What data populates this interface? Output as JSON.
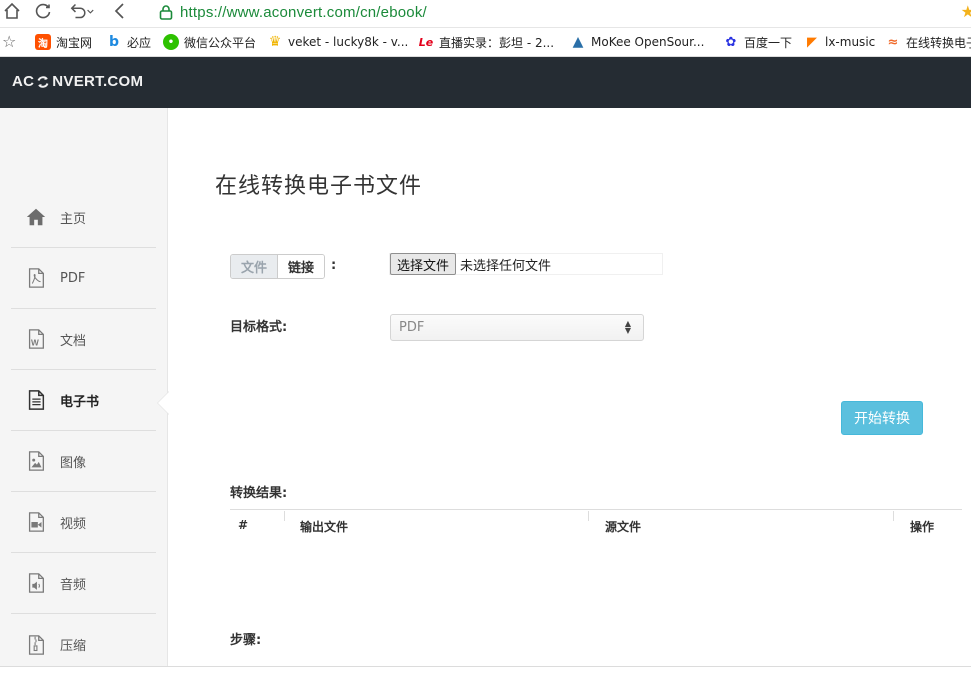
{
  "browser": {
    "url": "https://www.aconvert.com/cn/ebook/",
    "bookmarks": [
      {
        "label": "淘宝网",
        "icon": "taobao-icon",
        "color": "#ff5000",
        "glyph": "淘"
      },
      {
        "label": "必应",
        "icon": "bing-icon",
        "color": "#1e8ae0",
        "glyph": "b"
      },
      {
        "label": "微信公众平台",
        "icon": "wechat-icon",
        "color": "#2dc100",
        "glyph": "●"
      },
      {
        "label": "veket - lucky8k - v...",
        "icon": "trophy-icon",
        "color": "#f0b400",
        "glyph": "♛"
      },
      {
        "label": "直播实录：彭坦 - 2...",
        "icon": "letv-icon",
        "color": "#e3001b",
        "glyph": "Le"
      },
      {
        "label": "MoKee OpenSour...",
        "icon": "mokee-icon",
        "color": "#2a6fa8",
        "glyph": "M"
      },
      {
        "label": "百度一下",
        "icon": "baidu-icon",
        "color": "#2932e1",
        "glyph": "百"
      },
      {
        "label": "lx-music",
        "icon": "lx-music-icon",
        "color": "#ff7a00",
        "glyph": "▶"
      },
      {
        "label": "在线转换电子",
        "icon": "aconvert-icon",
        "color": "#f06a2a",
        "glyph": "≈"
      }
    ]
  },
  "site": {
    "logo_left": "AC",
    "logo_right": "NVERT.COM"
  },
  "sidebar": {
    "items": [
      {
        "label": "主页",
        "icon": "home-icon",
        "active": false
      },
      {
        "label": "PDF",
        "icon": "pdf-file-icon",
        "active": false
      },
      {
        "label": "文档",
        "icon": "word-document-icon",
        "active": false
      },
      {
        "label": "电子书",
        "icon": "ebook-icon",
        "active": true
      },
      {
        "label": "图像",
        "icon": "image-icon",
        "active": false
      },
      {
        "label": "视频",
        "icon": "video-icon",
        "active": false
      },
      {
        "label": "音频",
        "icon": "audio-icon",
        "active": false
      },
      {
        "label": "压缩",
        "icon": "archive-icon",
        "active": false
      }
    ]
  },
  "main": {
    "title": "在线转换电子书文件",
    "tabs": {
      "file": "文件",
      "link": "链接",
      "colon": ":"
    },
    "file_input": {
      "button": "选择文件",
      "status": "未选择任何文件"
    },
    "format": {
      "label": "目标格式:",
      "selected": "PDF"
    },
    "convert_button": "开始转换",
    "results": {
      "label": "转换结果:",
      "columns": [
        "#",
        "输出文件",
        "源文件",
        "操作"
      ]
    },
    "steps_label": "步骤:"
  },
  "colors": {
    "header_bg": "#252c33",
    "sidebar_bg": "#f5f5f5",
    "convert_button_bg": "#5bc0de",
    "url_green": "#1b8a3a"
  }
}
